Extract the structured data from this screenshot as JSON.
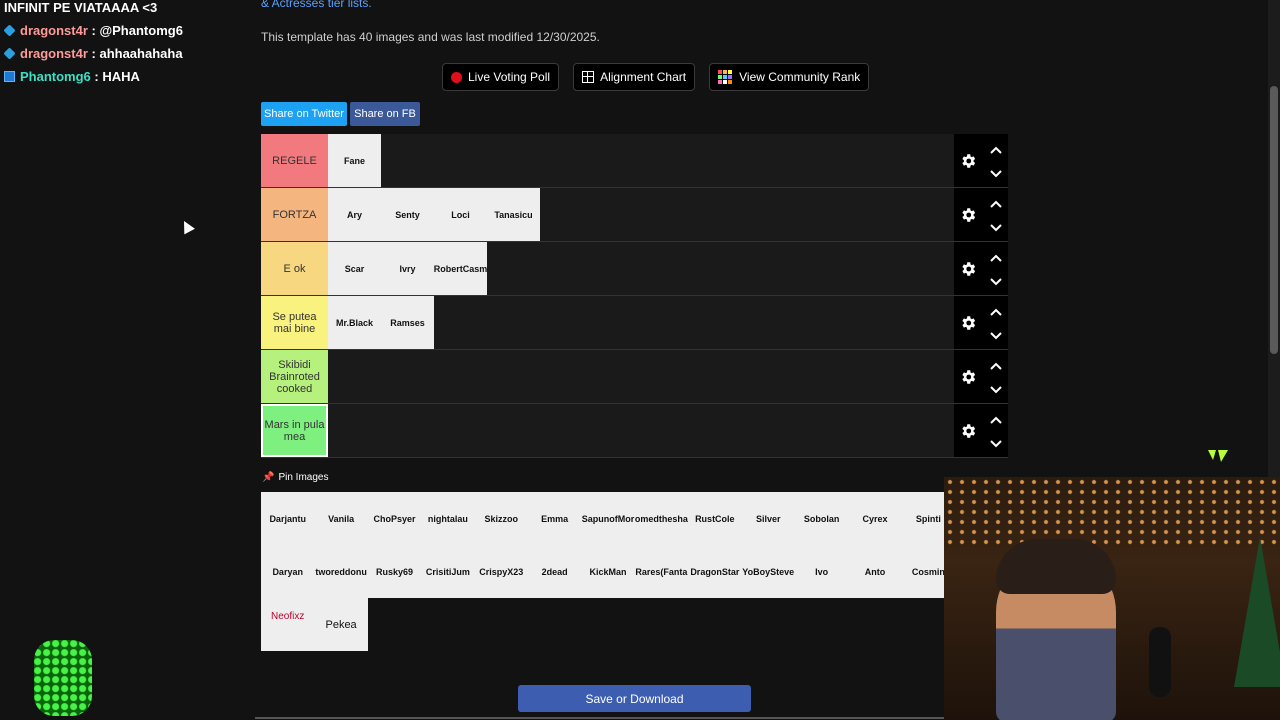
{
  "chat": [
    {
      "user": "",
      "message": "INFINIT PE VIATAAAA <3",
      "user_color": "#ffffff",
      "badge": ""
    },
    {
      "user": "dragonst4r",
      "message": " : @Phantomg6",
      "user_color": "#ff9a9a",
      "badge": "cube-badge-icon"
    },
    {
      "user": "dragonst4r",
      "message": " : ahhaahahaha",
      "user_color": "#ff9a9a",
      "badge": "cube-badge-icon"
    },
    {
      "user": "Phantomg6",
      "message": " : HAHA",
      "user_color": "#3de0c6",
      "badge": "prime-badge-icon"
    }
  ],
  "page": {
    "link_text": "& Actresses tier lists.",
    "description": "This template has 40 images and was last modified 12/30/2025."
  },
  "toolbar": {
    "live_voting": "Live Voting Poll",
    "alignment_chart": "Alignment Chart",
    "community_rank": "View Community Rank"
  },
  "share": {
    "twitter": "Share on Twitter",
    "facebook": "Share on FB"
  },
  "tiers": [
    {
      "label": "REGELE",
      "color": "#f27a7e",
      "items": [
        "Fane"
      ]
    },
    {
      "label": "FORTZA",
      "color": "#f5b57f",
      "items": [
        "Ary",
        "Senty",
        "Loci",
        "Tanasicu"
      ]
    },
    {
      "label": "E ok",
      "color": "#f7d880",
      "items": [
        "Scar",
        "Ivry",
        "RobertCasm"
      ]
    },
    {
      "label": "Se putea mai bine",
      "color": "#f9f27f",
      "items": [
        "Mr.Black",
        "Ramses"
      ]
    },
    {
      "label": "Skibidi Brainroted cooked",
      "color": "#b6f07d",
      "items": []
    },
    {
      "label": "Mars in pula mea",
      "color": "#7ef07f",
      "items": []
    }
  ],
  "pin_label": "Pin Images",
  "pool": {
    "row1": [
      "Darjantu",
      "Vanila",
      "ChoPsyer",
      "nightalau",
      "Skizzoo",
      "Emma",
      "SapunofMor",
      "omedthesha",
      "RustCole",
      "Silver",
      "Sobolan",
      "Cyrex",
      "Spinti"
    ],
    "row2": [
      "Daryan",
      "tworeddonu",
      "Rusky69",
      "CrisitiJum",
      "CrispyX23",
      "2dead",
      "KickMan",
      "Rares(Fanta",
      "DragonStar",
      "YoBoySteve",
      "Ivo",
      "Anto",
      "Cosmin"
    ],
    "row3": [
      "Neofixz",
      "Pekea"
    ]
  },
  "save_label": "Save or Download"
}
